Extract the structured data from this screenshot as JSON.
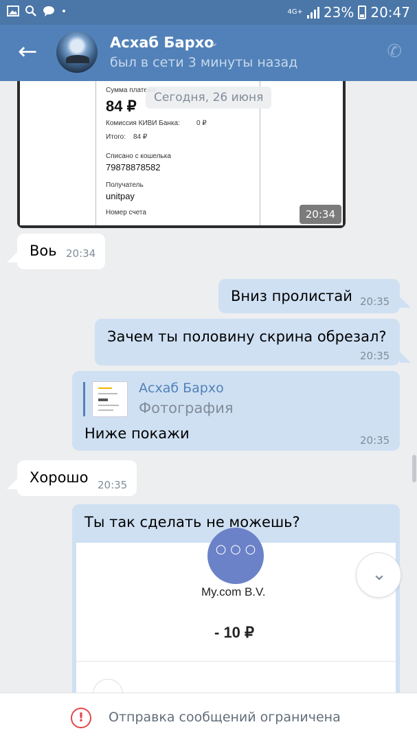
{
  "status_bar": {
    "network": "4G+",
    "battery": "23%",
    "time": "20:47",
    "icons": [
      "image-icon",
      "search-icon",
      "chat-icon",
      "dot-icon"
    ]
  },
  "header": {
    "name": "Асхаб Бархо",
    "status": "был в сети 3 минуты назад",
    "back_icon": "←",
    "dropdown_icon": "⌄",
    "call_icon": "✆"
  },
  "photo_message": {
    "time": "20:34",
    "receipt": {
      "amount_label": "Сумма платежа",
      "amount": "84 ₽",
      "fee_label": "Комиссия КИВИ Банка:",
      "fee_value": "0 ₽",
      "total_label": "Итого:",
      "total_value": "84 ₽",
      "wallet_label": "Списано с кошелька",
      "wallet_value": "79878878582",
      "recipient_label": "Получатель",
      "recipient_value": "unitpay",
      "account_label": "Номер счета"
    }
  },
  "date_separator": "Сегодня, 26 июня",
  "messages": [
    {
      "direction": "in",
      "text": "Воь",
      "time": "20:34"
    },
    {
      "direction": "out",
      "text": "Вниз пролистай",
      "time": "20:35"
    },
    {
      "direction": "out",
      "text": "Зачем ты половину скрина обрезал?",
      "time": "20:35"
    },
    {
      "direction": "out",
      "text": "Ниже покажи",
      "time": "20:35",
      "reply_author": "Асхаб Бархо",
      "reply_type": "Фотография"
    },
    {
      "direction": "in",
      "text": "Хорошо",
      "time": "20:35"
    },
    {
      "direction": "out",
      "text": "Ты так сделать не можешь?"
    }
  ],
  "attachment_card": {
    "dots": "○ ○ ○",
    "merchant": "My.com B.V.",
    "amount": "- 10 ₽"
  },
  "scroll_down_icon": "⌄",
  "footer": {
    "warning_icon": "!",
    "text": "Отправка сообщений ограничена"
  },
  "colors": {
    "header": "#5181b8",
    "status_bar": "#4a76a8",
    "outgoing_bubble": "#cfe0f3",
    "incoming_bubble": "#ffffff",
    "background": "#edeef0",
    "warning": "#e64646"
  }
}
